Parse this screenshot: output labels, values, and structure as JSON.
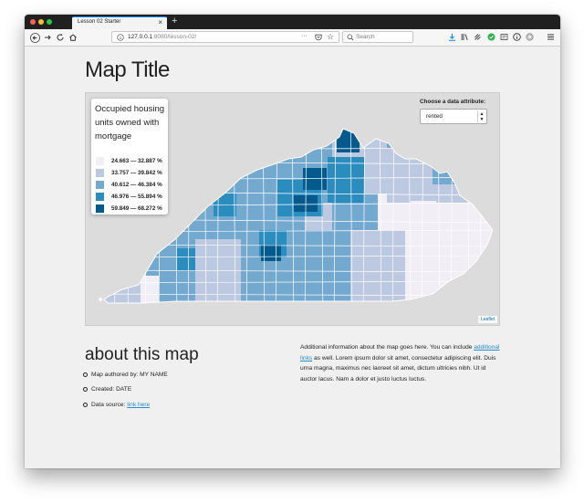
{
  "browser": {
    "tab_title": "Lesson 02 Starter",
    "tab_close": "×",
    "new_tab": "+",
    "url_host": "127.0.0.1",
    "url_path": ":8080/lesson-02/",
    "url_more": "···",
    "search_placeholder": "Search"
  },
  "page": {
    "title": "Map Title",
    "about_title": "about this map",
    "about_items": [
      {
        "text": "Map authored by: MY NAME"
      },
      {
        "text": "Created: DATE"
      },
      {
        "text": "Data source: ",
        "link": "link here"
      }
    ],
    "description": {
      "pre": "Additional information about the map goes here. You can include ",
      "link": "additional links",
      "post": " as well. Lorem ipsum dolor sit amet, consectetur adipiscing elit. Duis urna magna, maximus nec laoreet sit amet, dictum ultricies nibh. Ut id auctor lacus. Nam a dolor et justo luctus luctus."
    }
  },
  "map": {
    "legend_title": "Occupied housing units owned with mortgage",
    "legend": [
      {
        "label": "24.663 — 32.887 %",
        "color": "#f1eef6"
      },
      {
        "label": "33.757 — 39.842 %",
        "color": "#bdc9e1"
      },
      {
        "label": "40.612 — 46.384 %",
        "color": "#74a9cf"
      },
      {
        "label": "46.976 — 55.894 %",
        "color": "#2b8cbe"
      },
      {
        "label": "59.849 — 68.272 %",
        "color": "#045a8d"
      }
    ],
    "attribute_label": "Choose a data attribute:",
    "attribute_selected": "rented",
    "attribution": "Leaflet"
  },
  "colors": {
    "tab_accent": "#0a84ff",
    "link": "#2a8bd2",
    "download_icon": "#0a84ff",
    "extension_green": "#2eb34a"
  }
}
